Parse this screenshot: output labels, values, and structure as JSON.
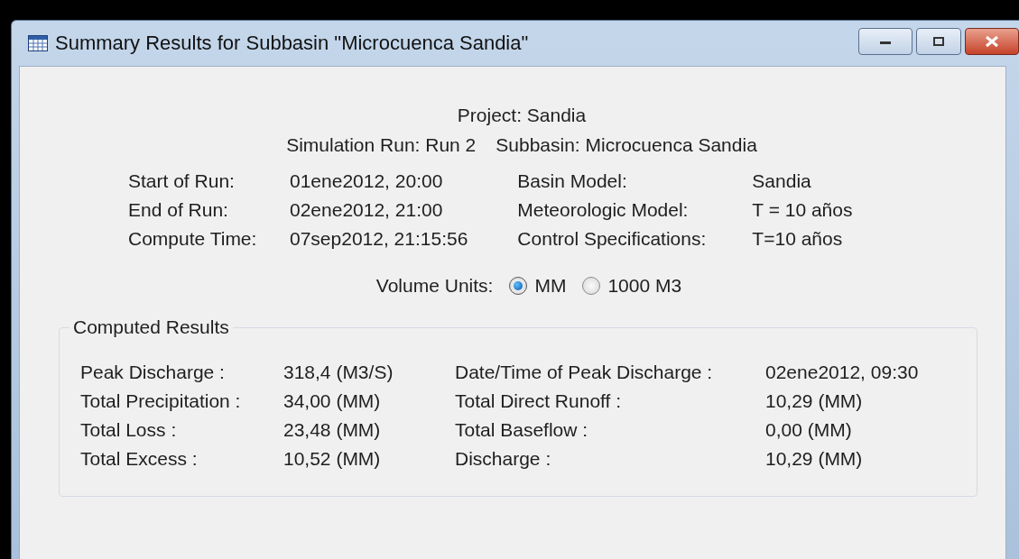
{
  "window": {
    "title": "Summary Results for Subbasin \"Microcuenca Sandia\""
  },
  "header": {
    "project": "Project: Sandia",
    "simulation_run": "Simulation Run: Run 2",
    "subbasin": "Subbasin: Microcuenca Sandia"
  },
  "run_info": {
    "left": [
      {
        "label": "Start of Run:",
        "value": "01ene2012, 20:00"
      },
      {
        "label": "End of Run:",
        "value": "02ene2012, 21:00"
      },
      {
        "label": "Compute Time:",
        "value": "07sep2012, 21:15:56"
      }
    ],
    "right": [
      {
        "label": "Basin Model:",
        "value": "Sandia"
      },
      {
        "label": "Meteorologic Model:",
        "value": "T = 10 años"
      },
      {
        "label": "Control Specifications:",
        "value": "T=10 años"
      }
    ]
  },
  "volume_units": {
    "label": "Volume Units:",
    "options": [
      {
        "label": "MM",
        "selected": true
      },
      {
        "label": "1000 M3",
        "selected": false
      }
    ]
  },
  "computed_results": {
    "title": "Computed Results",
    "left": [
      {
        "label": "Peak Discharge :",
        "value": "318,4 (M3/S)"
      },
      {
        "label": "Total Precipitation :",
        "value": "34,00 (MM)"
      },
      {
        "label": "Total Loss :",
        "value": "23,48 (MM)"
      },
      {
        "label": "Total Excess :",
        "value": "10,52 (MM)"
      }
    ],
    "right": [
      {
        "label": "Date/Time of Peak Discharge :",
        "value": "02ene2012, 09:30"
      },
      {
        "label": "Total Direct Runoff :",
        "value": "10,29 (MM)"
      },
      {
        "label": "Total Baseflow :",
        "value": "0,00 (MM)"
      },
      {
        "label": "Discharge :",
        "value": "10,29 (MM)"
      }
    ]
  }
}
